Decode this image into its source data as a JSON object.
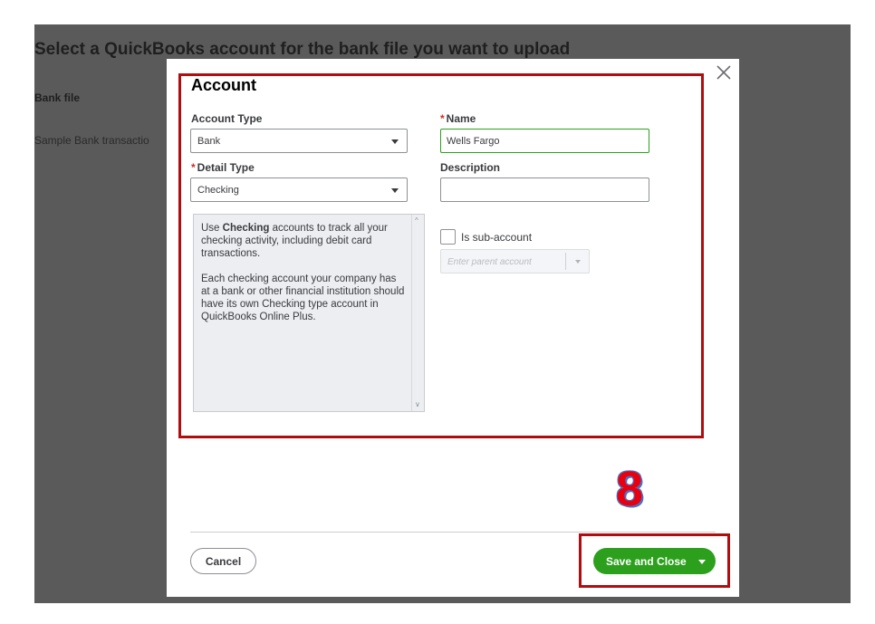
{
  "background": {
    "title": "Select a QuickBooks account for the bank file you want to upload",
    "bank_file_label": "Bank file",
    "bank_file_name": "Sample Bank transactio"
  },
  "modal": {
    "title": "Account",
    "account_type": {
      "label": "Account Type",
      "value": "Bank"
    },
    "detail_type": {
      "label": "Detail Type",
      "value": "Checking"
    },
    "name": {
      "label": "Name",
      "value": "Wells Fargo"
    },
    "description": {
      "label": "Description",
      "value": ""
    },
    "detail_description": {
      "prefix": "Use ",
      "bold": "Checking",
      "suffix": " accounts to track all your checking activity, including debit card transactions.",
      "paragraph2": "Each checking account your company has at a bank or other financial institution should have its own Checking type account in QuickBooks Online Plus."
    },
    "sub_account": {
      "label": "Is sub-account",
      "checked": false,
      "parent_placeholder": "Enter parent account"
    },
    "required_marker": "*",
    "cancel_label": "Cancel",
    "save_label": "Save and Close"
  },
  "annotation": {
    "step_number": "8"
  },
  "colors": {
    "accent_green": "#2ca01c",
    "highlight_red": "#b00d10",
    "required_red": "#d52b1e",
    "backdrop": "#5a5a5b"
  }
}
